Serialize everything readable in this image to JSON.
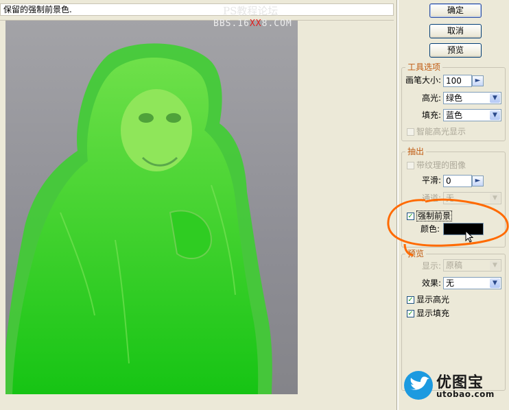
{
  "hint_text": "保留的强制前景色.",
  "watermark": {
    "line1": "PS教程论坛",
    "prefix": "BBS.16",
    "red": "XX",
    "suffix": "8.COM"
  },
  "buttons": {
    "ok": "确定",
    "cancel": "取消",
    "preview": "预览"
  },
  "tool_options": {
    "title": "工具选项",
    "brush_size_label": "画笔大小:",
    "brush_size_value": "100",
    "highlight_label": "高光:",
    "highlight_value": "绿色",
    "fill_label": "填充:",
    "fill_value": "蓝色",
    "smart_highlight_label": "智能高光显示",
    "smart_highlight_checked": false
  },
  "extract": {
    "title": "抽出",
    "textured_image_label": "带纹理的图像",
    "smooth_label": "平滑:",
    "smooth_value": "0",
    "channel_label": "通道:",
    "channel_value": "无",
    "force_fg_label": "强制前景",
    "force_fg_checked": true,
    "color_label": "颜色:",
    "color_value": "#000000"
  },
  "preview_group": {
    "title": "预览",
    "show_label": "显示:",
    "show_value": "原稿",
    "effect_label": "效果:",
    "effect_value": "无",
    "show_highlight_label": "显示高光",
    "show_highlight_checked": true,
    "show_fill_label": "显示填充",
    "show_fill_checked": true
  },
  "logo": {
    "name": "优图宝",
    "url": "utobao.com"
  },
  "colors": {
    "highlight_green": "#22d11d",
    "annotation_orange": "#ff6a00",
    "logo_blue": "#1c9ae0"
  }
}
